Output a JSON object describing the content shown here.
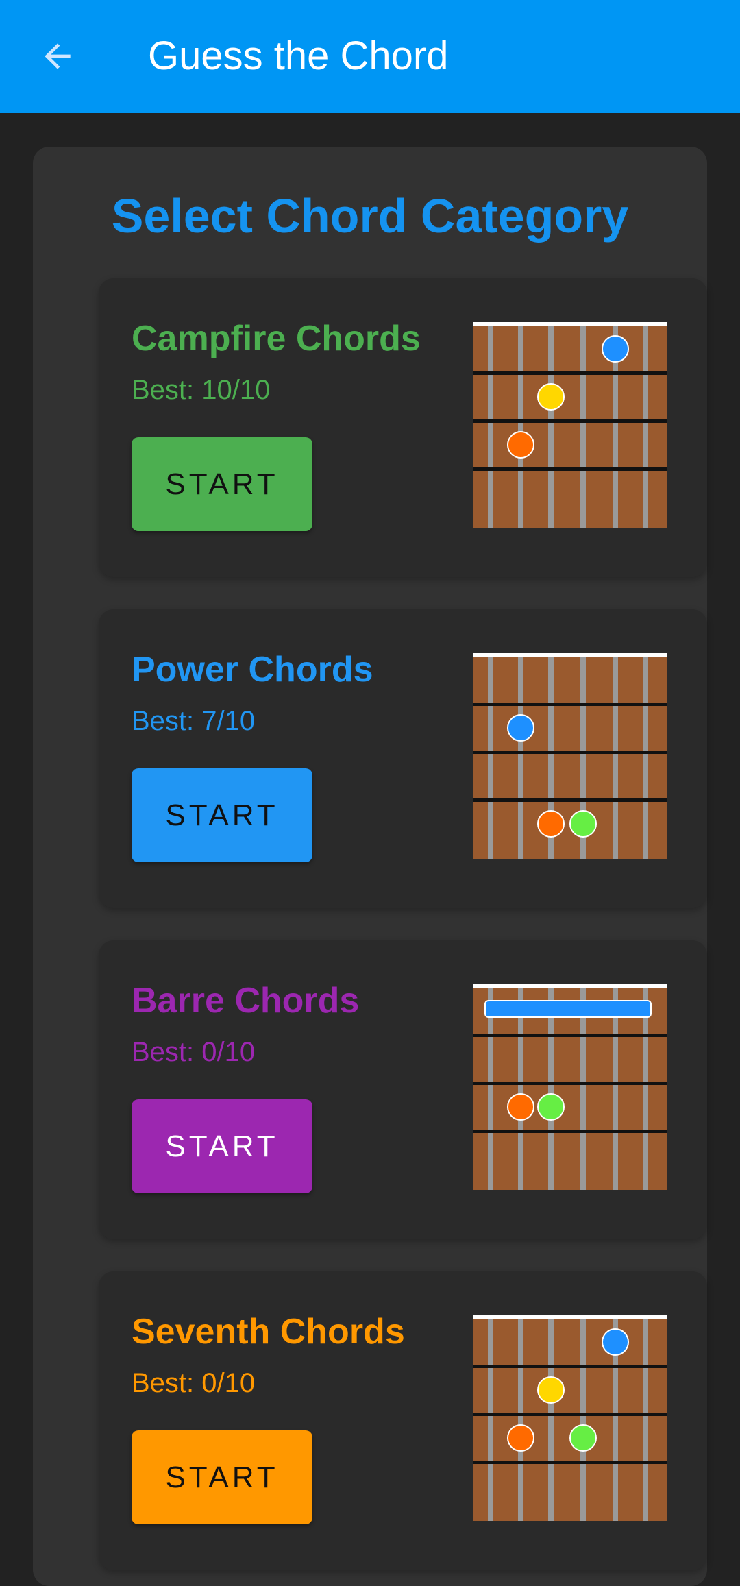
{
  "app": {
    "title": "Guess the Chord",
    "back_icon": "arrow-left-icon"
  },
  "screen": {
    "heading": "Select Chord Category"
  },
  "categories": [
    {
      "name": "Campfire Chords",
      "best": "Best: 10/10",
      "start_label": "START",
      "color": "#4caf50",
      "button_text_color": "#111111",
      "barre": false,
      "dots": [
        {
          "string": 5,
          "fret": 1,
          "color": "#1e90ff"
        },
        {
          "string": 3,
          "fret": 2,
          "color": "#ffd700"
        },
        {
          "string": 2,
          "fret": 3,
          "color": "#ff6a00"
        }
      ]
    },
    {
      "name": "Power Chords",
      "best": "Best: 7/10",
      "start_label": "START",
      "color": "#2196f3",
      "button_text_color": "#111111",
      "barre": false,
      "dots": [
        {
          "string": 2,
          "fret": 2,
          "color": "#1e90ff"
        },
        {
          "string": 3,
          "fret": 4,
          "color": "#ff6a00"
        },
        {
          "string": 4,
          "fret": 4,
          "color": "#66ee44"
        }
      ]
    },
    {
      "name": "Barre Chords",
      "best": "Best: 0/10",
      "start_label": "START",
      "color": "#9c27b0",
      "button_text_color": "#ffffff",
      "barre": true,
      "barre_color": "#1e90ff",
      "dots": [
        {
          "string": 2,
          "fret": 3,
          "color": "#ff6a00"
        },
        {
          "string": 3,
          "fret": 3,
          "color": "#66ee44"
        }
      ]
    },
    {
      "name": "Seventh Chords",
      "best": "Best: 0/10",
      "start_label": "START",
      "color": "#ff9800",
      "button_text_color": "#111111",
      "barre": false,
      "dots": [
        {
          "string": 5,
          "fret": 1,
          "color": "#1e90ff"
        },
        {
          "string": 3,
          "fret": 2,
          "color": "#ffd700"
        },
        {
          "string": 2,
          "fret": 3,
          "color": "#ff6a00"
        },
        {
          "string": 4,
          "fret": 3,
          "color": "#66ee44"
        }
      ]
    }
  ]
}
